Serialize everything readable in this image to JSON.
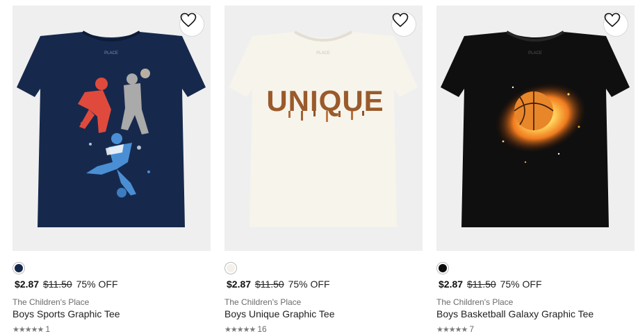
{
  "products": [
    {
      "price": "$2.87",
      "old_price": "$11.50",
      "discount": "75% OFF",
      "brand": "The Children's Place",
      "name": "Boys Sports Graphic Tee",
      "stars": "★★★★★",
      "rating_count": "1",
      "rating_value": 5,
      "swatch_color": "#15284b",
      "shirt_color": "#16294d",
      "image_text": ""
    },
    {
      "price": "$2.87",
      "old_price": "$11.50",
      "discount": "75% OFF",
      "brand": "The Children's Place",
      "name": "Boys Unique Graphic Tee",
      "stars": "★★★★★",
      "rating_count": "16",
      "rating_value": 5,
      "swatch_color": "#f3f1ea",
      "shirt_color": "#f7f4ec",
      "image_text": "UNIQUE"
    },
    {
      "price": "$2.87",
      "old_price": "$11.50",
      "discount": "75% OFF",
      "brand": "The Children's Place",
      "name": "Boys Basketball Galaxy Graphic Tee",
      "stars": "★★★★★",
      "rating_count": "7",
      "rating_value": 5,
      "swatch_color": "#0c0c0c",
      "shirt_color": "#0f0f0f",
      "image_text": ""
    }
  ],
  "icons": {
    "favorite": "heart-outline-icon",
    "star": "star-icon"
  },
  "colors": {
    "image_background": "#efefef",
    "price": "#111111",
    "muted_text": "#6b6b6b"
  }
}
